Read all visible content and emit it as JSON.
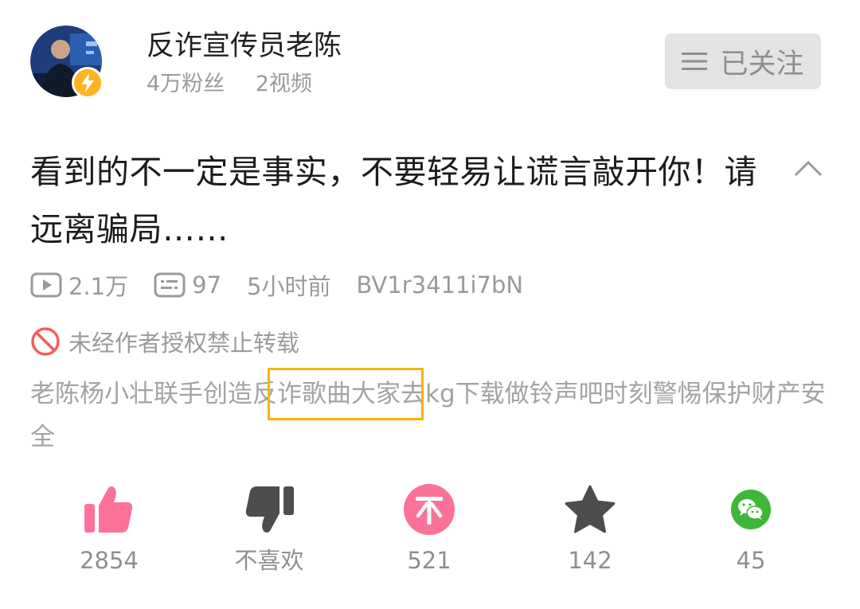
{
  "author": {
    "name": "反诈宣传员老陈",
    "fans": "4万粉丝",
    "videos": "2视频",
    "follow_label": "已关注"
  },
  "video": {
    "title": "看到的不一定是事实，不要轻易让谎言敲开你！请远离骗局……",
    "plays": "2.1万",
    "comments": "97",
    "time_ago": "5小时前",
    "bvid": "BV1r3411i7bN",
    "copyright_notice": "未经作者授权禁止转载",
    "description": "老陈杨小壮联手创造反诈歌曲大家去kg下载做铃声吧时刻警惕保护财产安全"
  },
  "actions": [
    {
      "name": "like",
      "icon": "thumbs-up-icon",
      "label": "2854",
      "color": "#fb7299"
    },
    {
      "name": "dislike",
      "icon": "thumbs-down-icon",
      "label": "不喜欢",
      "color": "#4d4d4d"
    },
    {
      "name": "coin",
      "icon": "coin-icon",
      "label": "521",
      "color": "#fb7299"
    },
    {
      "name": "favorite",
      "icon": "star-icon",
      "label": "142",
      "color": "#4d4d4d"
    },
    {
      "name": "share",
      "icon": "wechat-icon",
      "label": "45",
      "color": "#3fb637"
    }
  ],
  "colors": {
    "accent_pink": "#fb7299",
    "highlight": "#f6b600",
    "muted_text": "#9a9a9a"
  }
}
